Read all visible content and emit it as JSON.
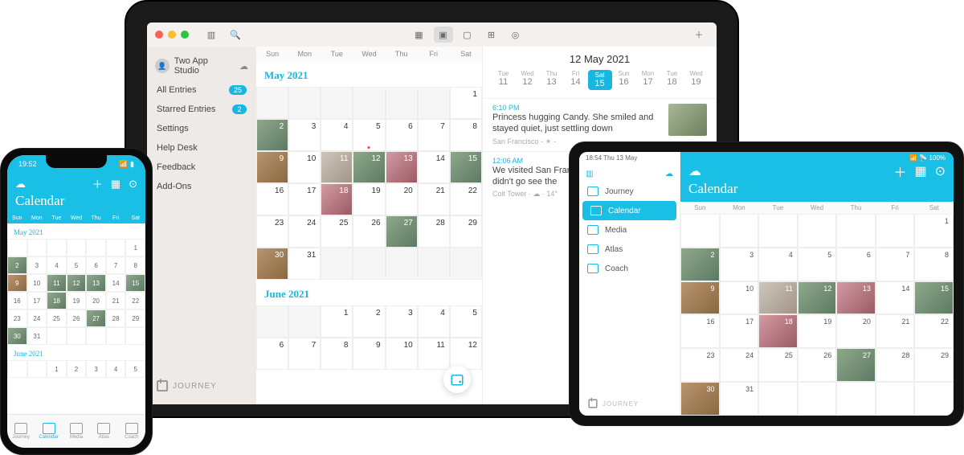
{
  "brand": "JOURNEY",
  "dow_short": [
    "Sun",
    "Mon",
    "Tue",
    "Wed",
    "Thu",
    "Fri",
    "Sat"
  ],
  "laptop": {
    "account": "Two App Studio",
    "sidebar": [
      {
        "label": "All Entries",
        "badge": "25"
      },
      {
        "label": "Starred Entries",
        "badge": "2"
      },
      {
        "label": "Settings"
      },
      {
        "label": "Help Desk"
      },
      {
        "label": "Feedback"
      },
      {
        "label": "Add-Ons"
      }
    ],
    "month1": "May 2021",
    "month2": "June 2021",
    "detail": {
      "date": "12 May 2021",
      "week": [
        {
          "d": "Tue",
          "n": "11"
        },
        {
          "d": "Wed",
          "n": "12"
        },
        {
          "d": "Thu",
          "n": "13"
        },
        {
          "d": "Fri",
          "n": "14"
        },
        {
          "d": "Sat",
          "n": "15",
          "sel": true
        },
        {
          "d": "Sun",
          "n": "16"
        },
        {
          "d": "Mon",
          "n": "17"
        },
        {
          "d": "Tue",
          "n": "18"
        },
        {
          "d": "Wed",
          "n": "19"
        }
      ],
      "entries": [
        {
          "time": "6:10 PM",
          "text": "Princess hugging Candy. She smiled and stayed quiet, just settling down",
          "loc": "San Francisco",
          "temp": "- ☀ -"
        },
        {
          "time": "12:06 AM",
          "text": "We visited San Francisco recently but we didn't go see the",
          "loc": "Coit Tower",
          "temp": "· ☁ · 14°"
        }
      ]
    },
    "may_cells": [
      {
        "n": "",
        "e": 1
      },
      {
        "n": "",
        "e": 1
      },
      {
        "n": "",
        "e": 1
      },
      {
        "n": "",
        "e": 1
      },
      {
        "n": "",
        "e": 1
      },
      {
        "n": "",
        "e": 1
      },
      {
        "n": "1"
      },
      {
        "n": "2",
        "h": 1
      },
      {
        "n": "3"
      },
      {
        "n": "4"
      },
      {
        "n": "5",
        "dot": 1
      },
      {
        "n": "6"
      },
      {
        "n": "7"
      },
      {
        "n": "8"
      },
      {
        "n": "9",
        "h": 1,
        "a": 1
      },
      {
        "n": "10"
      },
      {
        "n": "11",
        "h": 1,
        "a": 2
      },
      {
        "n": "12",
        "h": 1
      },
      {
        "n": "13",
        "h": 1,
        "a": 3
      },
      {
        "n": "14"
      },
      {
        "n": "15",
        "h": 1
      },
      {
        "n": "16"
      },
      {
        "n": "17"
      },
      {
        "n": "18",
        "h": 1,
        "a": 3
      },
      {
        "n": "19"
      },
      {
        "n": "20"
      },
      {
        "n": "21"
      },
      {
        "n": "22"
      },
      {
        "n": "23"
      },
      {
        "n": "24"
      },
      {
        "n": "25"
      },
      {
        "n": "26"
      },
      {
        "n": "27",
        "h": 1
      },
      {
        "n": "28"
      },
      {
        "n": "29"
      },
      {
        "n": "30",
        "h": 1,
        "a": 1
      },
      {
        "n": "31"
      },
      {
        "n": "",
        "e": 1
      },
      {
        "n": "",
        "e": 1
      },
      {
        "n": "",
        "e": 1
      },
      {
        "n": "",
        "e": 1
      },
      {
        "n": "",
        "e": 1
      }
    ],
    "june_cells": [
      {
        "n": "",
        "e": 1
      },
      {
        "n": "",
        "e": 1
      },
      {
        "n": "1"
      },
      {
        "n": "2"
      },
      {
        "n": "3"
      },
      {
        "n": "4"
      },
      {
        "n": "5"
      },
      {
        "n": "6"
      },
      {
        "n": "7"
      },
      {
        "n": "8"
      },
      {
        "n": "9"
      },
      {
        "n": "10"
      },
      {
        "n": "11"
      },
      {
        "n": "12"
      }
    ]
  },
  "phone": {
    "time": "19:52",
    "title": "Calendar",
    "month1": "May 2021",
    "month2": "June 2021",
    "may": [
      {
        "n": ""
      },
      {
        "n": ""
      },
      {
        "n": ""
      },
      {
        "n": ""
      },
      {
        "n": ""
      },
      {
        "n": ""
      },
      {
        "n": "1"
      },
      {
        "n": "2",
        "h": 1
      },
      {
        "n": "3"
      },
      {
        "n": "4"
      },
      {
        "n": "5"
      },
      {
        "n": "6"
      },
      {
        "n": "7"
      },
      {
        "n": "8"
      },
      {
        "n": "9",
        "h": 1,
        "a": 1
      },
      {
        "n": "10"
      },
      {
        "n": "11",
        "h": 1
      },
      {
        "n": "12",
        "h": 1
      },
      {
        "n": "13",
        "h": 1
      },
      {
        "n": "14"
      },
      {
        "n": "15",
        "h": 1
      },
      {
        "n": "16"
      },
      {
        "n": "17"
      },
      {
        "n": "18",
        "h": 1
      },
      {
        "n": "19"
      },
      {
        "n": "20"
      },
      {
        "n": "21"
      },
      {
        "n": "22"
      },
      {
        "n": "23"
      },
      {
        "n": "24"
      },
      {
        "n": "25"
      },
      {
        "n": "26"
      },
      {
        "n": "27",
        "h": 1
      },
      {
        "n": "28"
      },
      {
        "n": "29"
      },
      {
        "n": "30",
        "h": 1
      },
      {
        "n": "31"
      },
      {
        "n": ""
      },
      {
        "n": ""
      },
      {
        "n": ""
      },
      {
        "n": ""
      },
      {
        "n": ""
      }
    ],
    "june": [
      {
        "n": ""
      },
      {
        "n": ""
      },
      {
        "n": "1"
      },
      {
        "n": "2"
      },
      {
        "n": "3"
      },
      {
        "n": "4"
      },
      {
        "n": "5"
      }
    ],
    "tabs": [
      {
        "label": "Journey"
      },
      {
        "label": "Calendar",
        "active": true
      },
      {
        "label": "Media"
      },
      {
        "label": "Atlas"
      },
      {
        "label": "Coach"
      }
    ]
  },
  "tablet": {
    "status_time": "18:54  Thu 13 May",
    "status_right": "📶 📡 100%",
    "title": "Calendar",
    "sidebar": [
      {
        "label": "Journey"
      },
      {
        "label": "Calendar",
        "active": true
      },
      {
        "label": "Media"
      },
      {
        "label": "Atlas"
      },
      {
        "label": "Coach"
      }
    ],
    "cells": [
      {
        "n": ""
      },
      {
        "n": ""
      },
      {
        "n": ""
      },
      {
        "n": ""
      },
      {
        "n": ""
      },
      {
        "n": ""
      },
      {
        "n": "1"
      },
      {
        "n": "2",
        "h": 1
      },
      {
        "n": "3"
      },
      {
        "n": "4"
      },
      {
        "n": "5"
      },
      {
        "n": "6"
      },
      {
        "n": "7"
      },
      {
        "n": "8"
      },
      {
        "n": "9",
        "h": 1,
        "a": 1
      },
      {
        "n": "10"
      },
      {
        "n": "11",
        "h": 1,
        "a": 2
      },
      {
        "n": "12",
        "h": 1
      },
      {
        "n": "13",
        "h": 1,
        "a": 3
      },
      {
        "n": "14"
      },
      {
        "n": "15",
        "h": 1
      },
      {
        "n": "16"
      },
      {
        "n": "17"
      },
      {
        "n": "18",
        "h": 1,
        "a": 3
      },
      {
        "n": "19"
      },
      {
        "n": "20"
      },
      {
        "n": "21"
      },
      {
        "n": "22"
      },
      {
        "n": "23"
      },
      {
        "n": "24"
      },
      {
        "n": "25"
      },
      {
        "n": "26"
      },
      {
        "n": "27",
        "h": 1
      },
      {
        "n": "28"
      },
      {
        "n": "29"
      },
      {
        "n": "30",
        "h": 1,
        "a": 1
      },
      {
        "n": "31"
      },
      {
        "n": ""
      },
      {
        "n": ""
      },
      {
        "n": ""
      },
      {
        "n": ""
      },
      {
        "n": ""
      }
    ]
  }
}
